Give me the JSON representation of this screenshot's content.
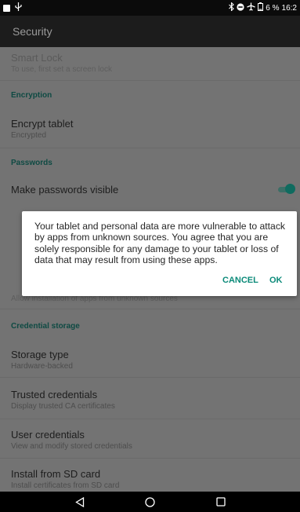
{
  "status_bar": {
    "left_icons": [
      "notification-square-icon",
      "usb-icon"
    ],
    "right_icons": [
      "bluetooth-icon",
      "do-not-disturb-icon",
      "airplane-icon",
      "battery-icon"
    ],
    "battery": "6 %",
    "time": "16:2"
  },
  "app_bar": {
    "title": "Security"
  },
  "settings": {
    "smart_lock": {
      "title": "Smart Lock",
      "subtitle": "To use, first set a screen lock"
    },
    "encryption_header": "Encryption",
    "encrypt_tablet": {
      "title": "Encrypt tablet",
      "subtitle": "Encrypted"
    },
    "passwords_header": "Passwords",
    "make_passwords_visible": {
      "title": "Make passwords visible",
      "enabled": true
    },
    "unknown_sources": {
      "subtitle": "Allow installation of apps from unknown sources"
    },
    "credential_storage_header": "Credential storage",
    "storage_type": {
      "title": "Storage type",
      "subtitle": "Hardware-backed"
    },
    "trusted_credentials": {
      "title": "Trusted credentials",
      "subtitle": "Display trusted CA certificates"
    },
    "user_credentials": {
      "title": "User credentials",
      "subtitle": "View and modify stored credentials"
    },
    "install_sd": {
      "title": "Install from SD card",
      "subtitle": "Install certificates from SD card"
    }
  },
  "dialog": {
    "message": "Your tablet and personal data are more vulnerable to attack by apps from unknown sources. You agree that you are solely responsible for any damage to your tablet or loss of data that may result from using these apps.",
    "cancel_label": "CANCEL",
    "ok_label": "OK"
  },
  "nav_bar": {
    "buttons": [
      "back-icon",
      "home-icon",
      "recents-icon"
    ]
  },
  "colors": {
    "accent": "#0b8a79",
    "scrim": "#737373",
    "app_bar": "#1c1c1c"
  }
}
